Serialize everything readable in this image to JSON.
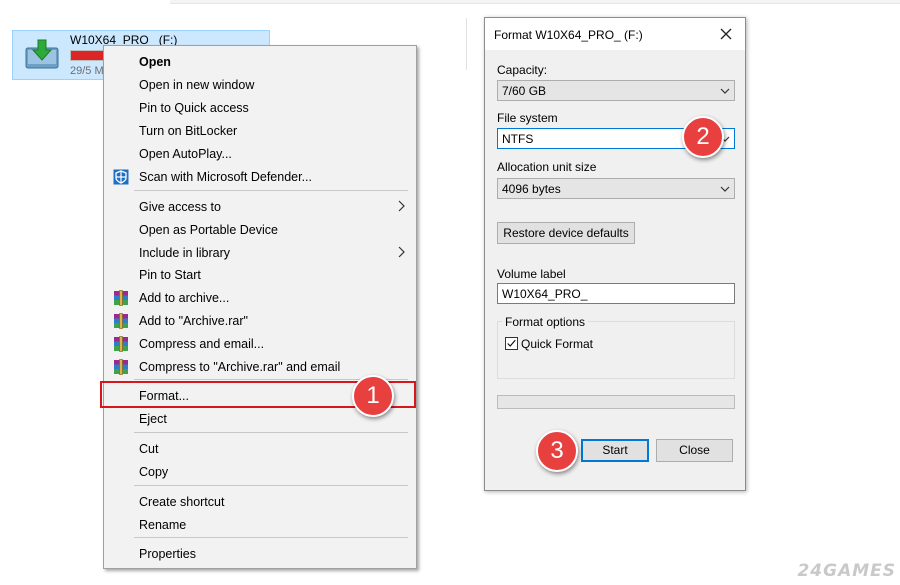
{
  "explorer": {
    "drive_name": "W10X64_PRO_ (F:)",
    "drive_size_text": "29/5 M",
    "drive_usage_fraction": 0.2
  },
  "context_menu": {
    "items": [
      {
        "label": "Open",
        "bold": true
      },
      {
        "label": "Open in new window"
      },
      {
        "label": "Pin to Quick access"
      },
      {
        "label": "Turn on BitLocker"
      },
      {
        "label": "Open AutoPlay..."
      },
      {
        "label": "Scan with Microsoft Defender...",
        "icon": "defender-shield-icon"
      },
      {
        "label": "Give access to",
        "submenu": true
      },
      {
        "label": "Open as Portable Device"
      },
      {
        "label": "Include in library",
        "submenu": true
      },
      {
        "label": "Pin to Start"
      },
      {
        "label": "Add to archive...",
        "icon": "winrar-icon"
      },
      {
        "label": "Add to \"Archive.rar\"",
        "icon": "winrar-icon"
      },
      {
        "label": "Compress and email...",
        "icon": "winrar-icon"
      },
      {
        "label": "Compress to \"Archive.rar\" and email",
        "icon": "winrar-icon"
      },
      {
        "label": "Format..."
      },
      {
        "label": "Eject"
      },
      {
        "label": "Cut"
      },
      {
        "label": "Copy"
      },
      {
        "label": "Create shortcut"
      },
      {
        "label": "Rename"
      },
      {
        "label": "Properties"
      }
    ]
  },
  "format_dialog": {
    "title": "Format W10X64_PRO_ (F:)",
    "capacity_label": "Capacity:",
    "capacity_value": "7/60 GB",
    "file_system_label": "File system",
    "file_system_value": "NTFS",
    "allocation_label": "Allocation unit size",
    "allocation_value": "4096 bytes",
    "restore_button": "Restore device defaults",
    "volume_label_label": "Volume label",
    "volume_label_value": "W10X64_PRO_",
    "format_options_label": "Format options",
    "quick_format_label": "Quick Format",
    "quick_format_checked": true,
    "progress_fraction": 0,
    "start_button": "Start",
    "close_button": "Close"
  },
  "steps": {
    "one": "1",
    "two": "2",
    "three": "3"
  },
  "watermark": "24GAMES",
  "colors": {
    "badge": "#e8403f",
    "highlight": "#d8161c",
    "selection": "#cce8ff",
    "focus": "#0078d7"
  }
}
